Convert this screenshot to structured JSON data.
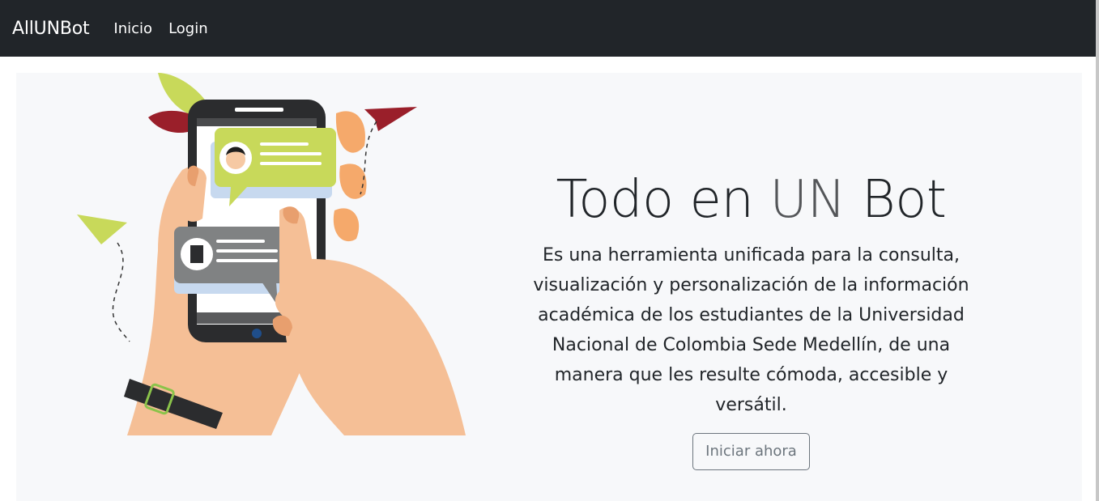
{
  "navbar": {
    "brand": "AllUNBot",
    "links": [
      "Inicio",
      "Login"
    ]
  },
  "hero": {
    "headline_part1": "Todo en ",
    "headline_part2": "UN",
    "headline_part3": " Bot",
    "description": "Es una herramienta unificada para la consulta, visualización y personalización de la información académica de los estudiantes de la Universidad Nacional de Colombia Sede Medellín, de una manera que les resulte cómoda, accesible y versátil.",
    "cta_label": "Iniciar ahora"
  },
  "colors": {
    "navbar_bg": "#212529",
    "hero_bg": "#f7f8fa",
    "accent_green": "#c8d95a",
    "bubble_gray": "#808283",
    "skin": "#f5bf96"
  },
  "icons": [
    "paper-plane-icon",
    "leaf-icon",
    "avatar-icon",
    "phone-icon",
    "watch-icon"
  ]
}
